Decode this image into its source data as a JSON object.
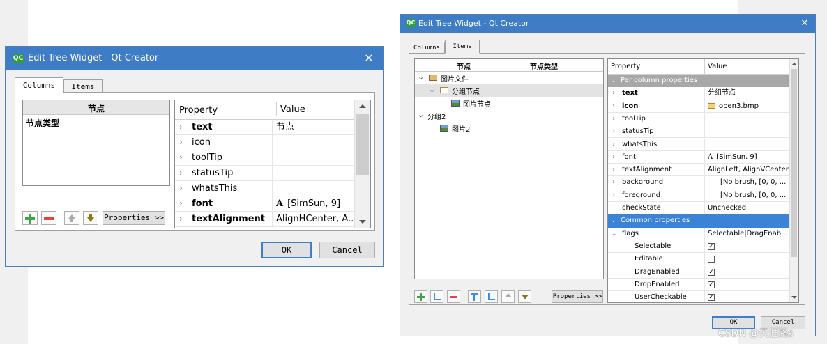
{
  "left_dialog": {
    "title": "Edit Tree Widget - Qt Creator",
    "app_badge": "QC",
    "close_glyph": "✕",
    "tabs": [
      "Columns",
      "Items"
    ],
    "list_header": "节点",
    "list_items": [
      "节点类型"
    ],
    "property_header": "Property",
    "value_header": "Value",
    "rows": [
      {
        "property": "text",
        "value": "节点",
        "bold": true
      },
      {
        "property": "icon",
        "value": "",
        "bold": false
      },
      {
        "property": "toolTip",
        "value": "",
        "bold": false
      },
      {
        "property": "statusTip",
        "value": "",
        "bold": false
      },
      {
        "property": "whatsThis",
        "value": "",
        "bold": false
      },
      {
        "property": "font",
        "value": "[SimSun, 9]",
        "bold": true
      },
      {
        "property": "textAlignment",
        "value": "AlignHCenter, A...",
        "bold": true
      }
    ],
    "font_glyph": "A",
    "properties_button": "Properties >>",
    "ok_button": "OK",
    "cancel_button": "Cancel"
  },
  "right_dialog": {
    "title": "Edit Tree Widget - Qt Creator",
    "app_badge": "QC",
    "close_glyph": "✕",
    "tabs": [
      "Columns",
      "Items"
    ],
    "tree_headers": [
      "节点",
      "节点类型"
    ],
    "tree": [
      {
        "label": "图片文件",
        "level": 0,
        "expander": "⌄"
      },
      {
        "label": "分组节点",
        "level": 1,
        "expander": "⌄"
      },
      {
        "label": "图片节点",
        "level": 2,
        "expander": ""
      },
      {
        "label": "分组2",
        "level": 0,
        "expander": "⌄"
      },
      {
        "label": "图片2",
        "level": 1,
        "expander": ""
      }
    ],
    "property_header": "Property",
    "value_header": "Value",
    "section_per_column": "Per column properties",
    "section_common": "Common properties",
    "rows": [
      {
        "property": "text",
        "value": "分组节点",
        "bold": true
      },
      {
        "property": "icon",
        "value": "open3.bmp",
        "bold": true
      },
      {
        "property": "toolTip",
        "value": "",
        "bold": false
      },
      {
        "property": "statusTip",
        "value": "",
        "bold": false
      },
      {
        "property": "whatsThis",
        "value": "",
        "bold": false
      },
      {
        "property": "font",
        "value": "[SimSun, 9]",
        "bold": false
      },
      {
        "property": "textAlignment",
        "value": "AlignLeft, AlignVCenter",
        "bold": false
      },
      {
        "property": "background",
        "value": "[No brush, [0, 0, ...",
        "bold": false
      },
      {
        "property": "foreground",
        "value": "[No brush, [0, 0, ...",
        "bold": false
      },
      {
        "property": "checkState",
        "value": "Unchecked",
        "bold": false
      }
    ],
    "flags": {
      "property": "flags",
      "value": "Selectable|DragEnab..."
    },
    "flag_items": [
      {
        "name": "Selectable",
        "checked": true
      },
      {
        "name": "Editable",
        "checked": false
      },
      {
        "name": "DragEnabled",
        "checked": true
      },
      {
        "name": "DropEnabled",
        "checked": true
      },
      {
        "name": "UserCheckable",
        "checked": true
      }
    ],
    "font_glyph": "A",
    "check_glyph": "✓",
    "properties_button": "Properties >>",
    "ok_button": "OK",
    "cancel_button": "Cancel"
  },
  "watermark": "CSDN @天涯路s"
}
